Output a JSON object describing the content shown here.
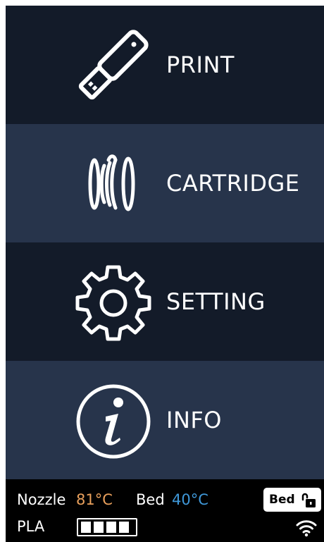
{
  "menu": {
    "items": [
      {
        "label": "PRINT",
        "icon": "usb-drive-icon"
      },
      {
        "label": "CARTRIDGE",
        "icon": "filament-spool-icon"
      },
      {
        "label": "SETTING",
        "icon": "gear-icon"
      },
      {
        "label": "INFO",
        "icon": "info-icon"
      }
    ]
  },
  "status": {
    "nozzle_label": "Nozzle",
    "nozzle_temp": "81°C",
    "bed_label": "Bed",
    "bed_temp": "40°C",
    "bed_lock_button_label": "Bed",
    "material": "PLA",
    "battery_level": 1.0,
    "wifi_icon": "wifi-icon",
    "lock_icon": "unlocked-icon"
  },
  "colors": {
    "menu_dark": "#131b29",
    "menu_light": "#27344b",
    "nozzle_temp": "#e9a05c",
    "bed_temp": "#3f98d9",
    "status_bg": "#000000"
  }
}
